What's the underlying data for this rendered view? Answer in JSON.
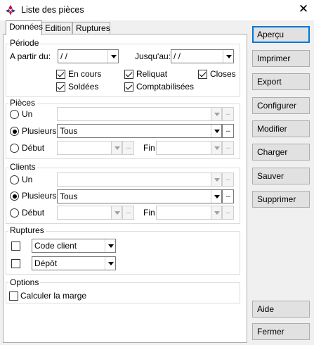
{
  "window": {
    "title": "Liste des pièces",
    "close_glyph": "✕"
  },
  "tabs": [
    "Données",
    "Edition",
    "Ruptures"
  ],
  "periode": {
    "label": "Période",
    "from_label": "A partir du:",
    "from_value": " / /",
    "to_label": "Jusqu'au:",
    "to_value": " / /",
    "checkboxes": [
      {
        "label": "En cours",
        "checked": true
      },
      {
        "label": "Reliquat",
        "checked": true
      },
      {
        "label": "Closes",
        "checked": true
      },
      {
        "label": "Soldées",
        "checked": true
      },
      {
        "label": "Comptabilisées",
        "checked": true
      }
    ]
  },
  "pieces": {
    "label": "Pièces",
    "radio_un": "Un",
    "radio_plusieurs": "Plusieurs",
    "radio_debut": "Début",
    "plusieurs_value": "Tous",
    "fin_label": "Fin",
    "selected": "Plusieurs"
  },
  "clients": {
    "label": "Clients",
    "radio_un": "Un",
    "radio_plusieurs": "Plusieurs",
    "radio_debut": "Début",
    "plusieurs_value": "Tous",
    "fin_label": "Fin",
    "selected": "Plusieurs"
  },
  "ruptures": {
    "label": "Ruptures",
    "rows": [
      {
        "checked": false,
        "value": "Code client"
      },
      {
        "checked": false,
        "value": "Dépôt"
      }
    ]
  },
  "options": {
    "label": "Options",
    "calculer_marge": "Calculer la marge",
    "calculer_marge_checked": false
  },
  "ellipsis": "...",
  "buttons": {
    "apercu": "Aperçu",
    "imprimer": "Imprimer",
    "export": "Export",
    "configurer": "Configurer",
    "modifier": "Modifier",
    "charger": "Charger",
    "sauver": "Sauver",
    "supprimer": "Supprimer",
    "aide": "Aide",
    "fermer": "Fermer"
  },
  "colors": {
    "accent": "#0078d7",
    "app_icon": "#c8102e"
  }
}
